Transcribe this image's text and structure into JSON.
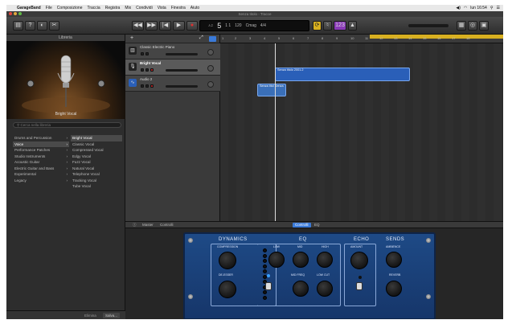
{
  "menubar": {
    "items": [
      "GarageBand",
      "File",
      "Composizione",
      "Traccia",
      "Registra",
      "Mix",
      "Condividi",
      "Vista",
      "Finestra",
      "Aiuto"
    ],
    "clock": "lun 16:54"
  },
  "window": {
    "title": "Senza titolo - Tracce"
  },
  "lcd": {
    "bar": "5",
    "beat": "1",
    "tempo_value": "1 1",
    "bpm": "120",
    "key": "Cmag",
    "sig": "4/4"
  },
  "library": {
    "title": "Libreria",
    "patch_name": "Bright Vocal",
    "search_placeholder": "Cerca nella libreria",
    "categories": [
      "Drums and Percussion",
      "Voice",
      "Performance Patches",
      "Studio Instruments",
      "Acoustic Guitar",
      "Electric Guitar and Bass",
      "Experimental",
      "Legacy"
    ],
    "patches": [
      "Bright Vocal",
      "Classic Vocal",
      "Compressed Vocal",
      "Edgy Vocal",
      "Fuzz Vocal",
      "Natural Vocal",
      "Telephone Vocal",
      "Tracking Vocal",
      "Tube Vocal"
    ],
    "footer": {
      "revert": "Elimina",
      "save": "Salva..."
    }
  },
  "tracks": [
    {
      "name": "Classic Electric Piano",
      "icon": "keyboard-icon"
    },
    {
      "name": "Bright Vocal",
      "icon": "microphone-icon"
    },
    {
      "name": "Audio 2",
      "icon": "waveform-icon"
    }
  ],
  "ruler": [
    "1",
    "2",
    "3",
    "4",
    "5",
    "6",
    "7",
    "8",
    "9",
    "10",
    "11",
    "12",
    "13",
    "14",
    "15",
    "16",
    "17",
    "18"
  ],
  "regions": [
    {
      "name": "Senza titolo 2001.2",
      "color": "#2a5fb8"
    },
    {
      "name": "Senza titol Senza",
      "color": "#3a6fb8"
    }
  ],
  "editor": {
    "tabs": {
      "master": "Master",
      "controls": "Controlli",
      "smart": "Controlli",
      "eq": "EQ"
    },
    "sections": {
      "dynamics": "DYNAMICS",
      "eq": "EQ",
      "echo": "ECHO",
      "sends": "SENDS"
    },
    "labels": {
      "compression": "COMPRESSION",
      "de_esser": "DE-ESSER",
      "low": "LOW",
      "mid": "MID",
      "high": "HIGH",
      "mid_freq": "MID FREQ",
      "low_cut": "LOW CUT",
      "amount": "AMOUNT",
      "ambience": "AMBIENCE",
      "reverb": "REVERB"
    }
  },
  "colors": {
    "accent_cycle": "#d8b020",
    "region_blue": "#2a5fb8",
    "pedal_blue": "#1e4a86"
  }
}
